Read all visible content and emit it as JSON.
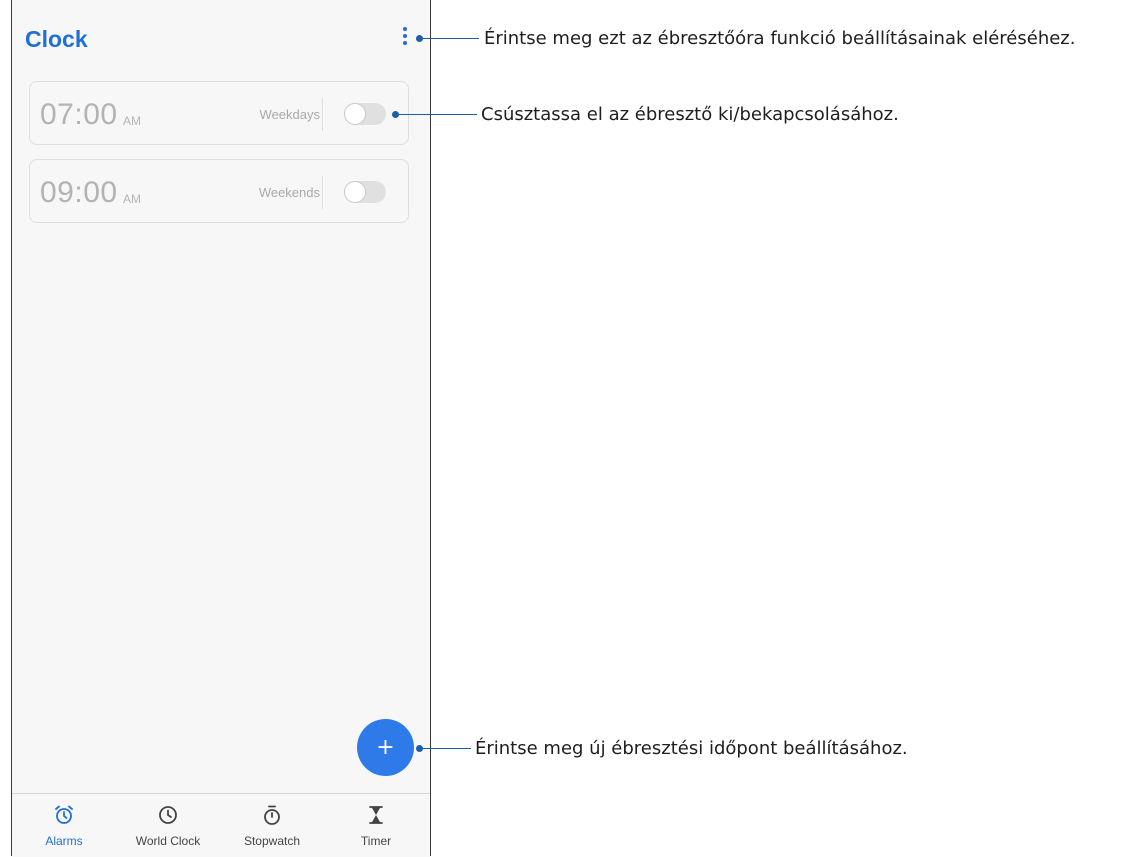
{
  "app": {
    "title": "Clock"
  },
  "alarms": [
    {
      "time": "07:00",
      "ampm": "AM",
      "days": "Weekdays",
      "enabled": false
    },
    {
      "time": "09:00",
      "ampm": "AM",
      "days": "Weekends",
      "enabled": false
    }
  ],
  "fab": {
    "label": "+"
  },
  "nav": [
    {
      "label": "Alarms",
      "icon": "alarm-clock-icon",
      "active": true
    },
    {
      "label": "World Clock",
      "icon": "clock-icon",
      "active": false
    },
    {
      "label": "Stopwatch",
      "icon": "stopwatch-icon",
      "active": false
    },
    {
      "label": "Timer",
      "icon": "hourglass-icon",
      "active": false
    }
  ],
  "callouts": [
    "Érintse meg ezt az ébresztőóra funkció beállításainak eléréséhez.",
    "Csúsztassa el az ébresztő ki/bekapcsolásához.",
    "Érintse meg új ébresztési időpont beállításához."
  ],
  "colors": {
    "accent": "#1f6fd6",
    "fab": "#2d7ae8",
    "callout_line": "#1b5fa6"
  }
}
